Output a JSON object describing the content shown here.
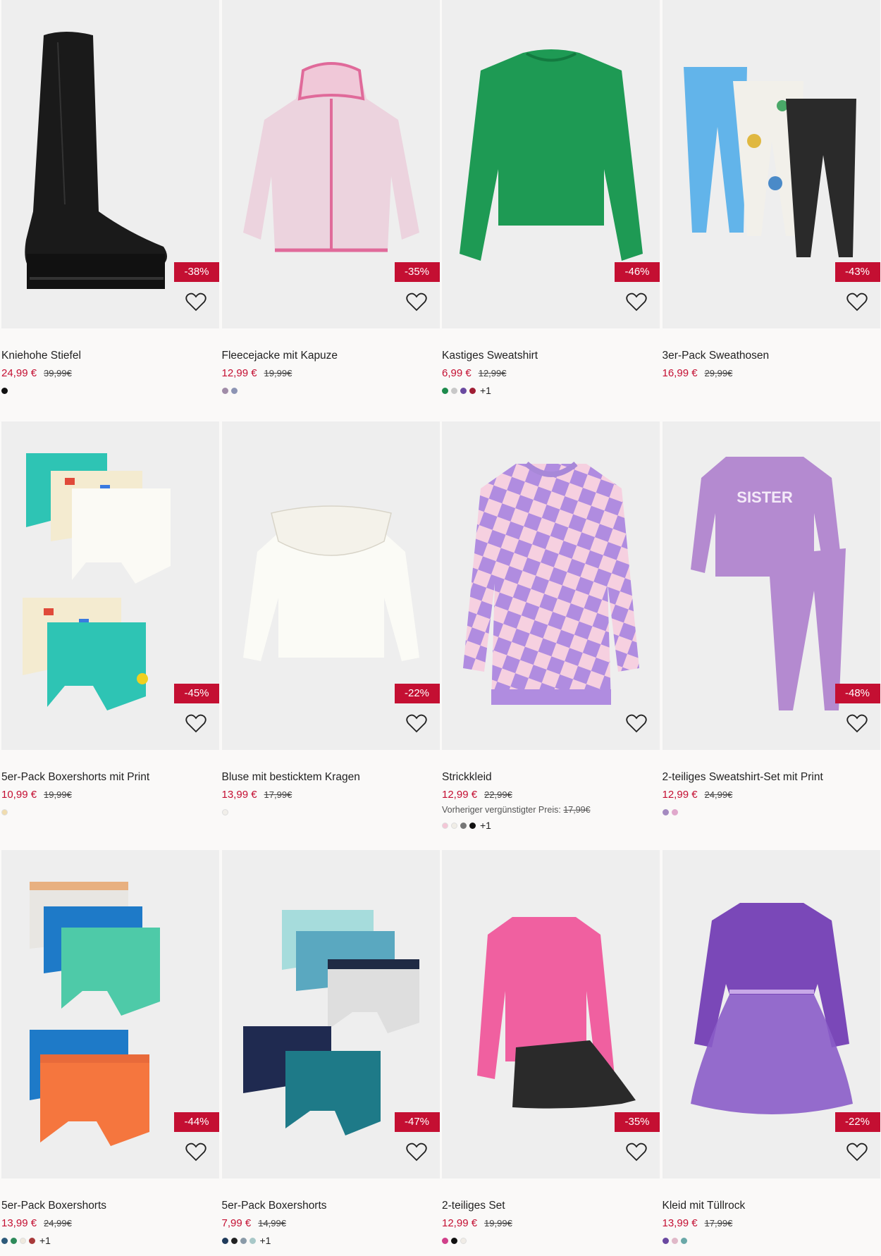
{
  "products": [
    {
      "name": "Kniehohe Stiefel",
      "price": "24,99 €",
      "old": "39,99€",
      "badge": "-38%",
      "prev": "",
      "prev_price": "",
      "swatches": [
        "#111111"
      ],
      "more": ""
    },
    {
      "name": "Fleecejacke mit Kapuze",
      "price": "12,99 €",
      "old": "19,99€",
      "badge": "-35%",
      "prev": "",
      "prev_price": "",
      "swatches": [
        "#a08ca8",
        "#8c94b4"
      ],
      "more": ""
    },
    {
      "name": "Kastiges Sweatshirt",
      "price": "6,99 €",
      "old": "12,99€",
      "badge": "-46%",
      "prev": "",
      "prev_price": "",
      "swatches": [
        "#1d8a4c",
        "#c8c8c8",
        "#6a4aa0",
        "#a01e34"
      ],
      "more": "+1"
    },
    {
      "name": "3er-Pack Sweathosen",
      "price": "16,99 €",
      "old": "29,99€",
      "badge": "-43%",
      "prev": "",
      "prev_price": "",
      "swatches": [],
      "more": ""
    },
    {
      "name": "5er-Pack Boxershorts mit Print",
      "price": "10,99 €",
      "old": "19,99€",
      "badge": "-45%",
      "prev": "",
      "prev_price": "",
      "swatches": [
        "#f0dcae"
      ],
      "more": ""
    },
    {
      "name": "Bluse mit besticktem Kragen",
      "price": "13,99 €",
      "old": "17,99€",
      "badge": "-22%",
      "prev": "",
      "prev_price": "",
      "swatches": [
        "#f1efea"
      ],
      "more": ""
    },
    {
      "name": "Strickkleid",
      "price": "12,99 €",
      "old": "22,99€",
      "badge": "",
      "prev": "Vorheriger vergünstigter Preis:",
      "prev_price": "17,99€",
      "swatches": [
        "#f4c6d6",
        "#f0ede6",
        "#777777",
        "#111111"
      ],
      "more": "+1"
    },
    {
      "name": "2-teiliges Sweatshirt-Set mit Print",
      "price": "12,99 €",
      "old": "24,99€",
      "badge": "-48%",
      "prev": "",
      "prev_price": "",
      "swatches": [
        "#a48ac0",
        "#e0a8cc"
      ],
      "more": ""
    },
    {
      "name": "5er-Pack Boxershorts",
      "price": "13,99 €",
      "old": "24,99€",
      "badge": "-44%",
      "prev": "",
      "prev_price": "",
      "swatches": [
        "#2e5a7a",
        "#2e8a5a",
        "#efe9de",
        "#a83a3a"
      ],
      "more": "+1"
    },
    {
      "name": "5er-Pack Boxershorts",
      "price": "7,99 €",
      "old": "14,99€",
      "badge": "-47%",
      "prev": "",
      "prev_price": "",
      "swatches": [
        "#1f3a5a",
        "#222222",
        "#8a9aa8",
        "#a8c8c8"
      ],
      "more": "+1"
    },
    {
      "name": "2-teiliges Set",
      "price": "12,99 €",
      "old": "19,99€",
      "badge": "-35%",
      "prev": "",
      "prev_price": "",
      "swatches": [
        "#d0408a",
        "#111111",
        "#f0ece6"
      ],
      "more": ""
    },
    {
      "name": "Kleid mit Tüllrock",
      "price": "13,99 €",
      "old": "17,99€",
      "badge": "-22%",
      "prev": "",
      "prev_price": "",
      "swatches": [
        "#6a48a0",
        "#e0b8c8",
        "#6aa8a8"
      ],
      "more": ""
    }
  ],
  "icons": {
    "favorite": "heart-outline-icon"
  },
  "colors": {
    "sale_red": "#c40f32",
    "image_bg": "#eeeeee"
  }
}
